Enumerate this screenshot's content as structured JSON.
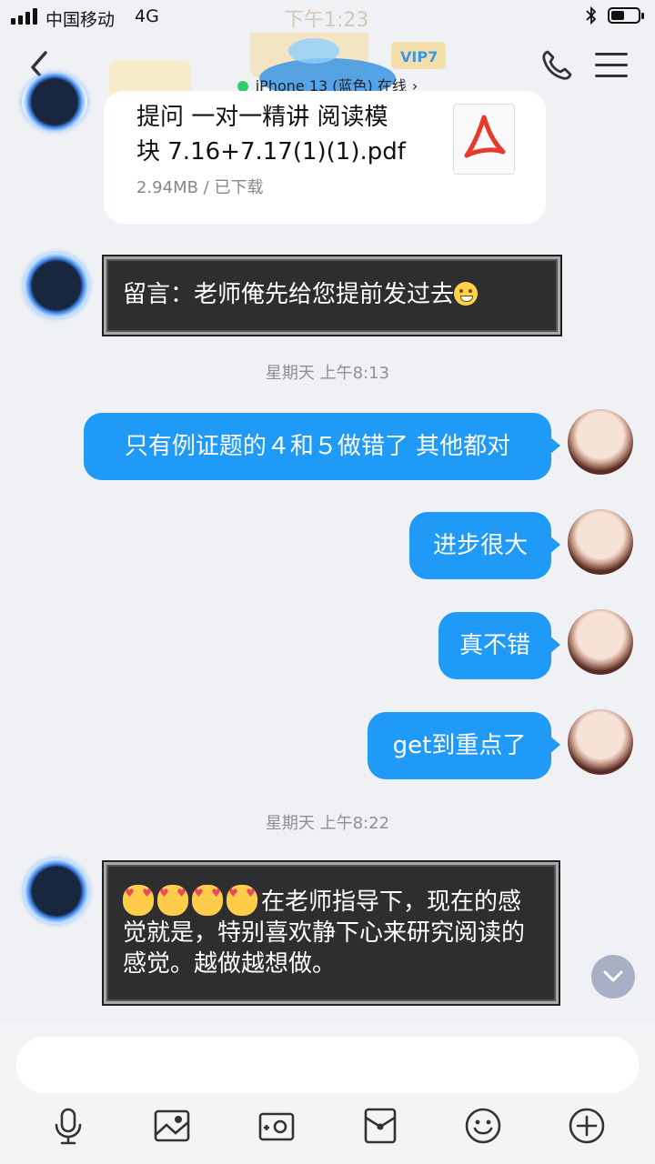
{
  "status_bar": {
    "carrier": "中国移动",
    "network": "4G",
    "time": "下午1:23",
    "battery_level": 0.5
  },
  "header": {
    "device_status": "iPhone 13 (蓝色) 在线",
    "header_badge": "VIP7"
  },
  "messages": {
    "file": {
      "name": "提问 一对一精讲 阅读模块 7.16+7.17(1)(1).pdf",
      "name_line1": "提问 一对一精讲 阅读模",
      "name_line2": "块 7.16+7.17(1)(1).pdf",
      "meta": "2.94MB / 已下载",
      "icon": "pdf-icon"
    },
    "left_note": "留言：老师俺先给您提前发过去",
    "time1": "星期天 上午8:13",
    "right": [
      "只有例证题的４和５做错了 其他都对",
      "进步很大",
      "真不错",
      "get到重点了"
    ],
    "time2": "星期天 上午8:22",
    "left_long": "在老师指导下，现在的感觉就是，特别喜欢静下心来研究阅读的感觉。越做越想做。"
  },
  "input": {
    "placeholder": ""
  },
  "toolbar": {
    "icons": [
      "microphone-icon",
      "image-icon",
      "camera-icon",
      "red-packet-icon",
      "emoji-icon",
      "plus-icon"
    ]
  },
  "colors": {
    "accent_blue": "#1f9af6",
    "dark_bubble": "#2e2e30",
    "background": "#f0f1f4"
  }
}
